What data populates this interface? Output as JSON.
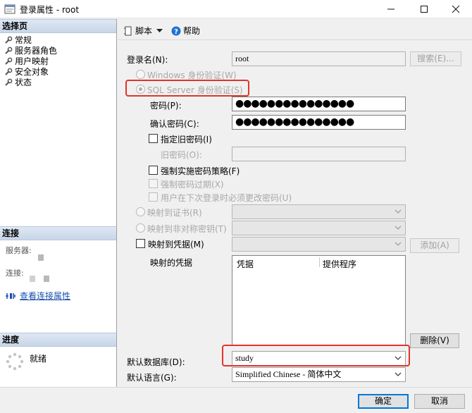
{
  "window": {
    "title": "登录属性 - root",
    "minimize_icon": "minimize-icon",
    "maximize_icon": "maximize-icon",
    "close_icon": "close-icon"
  },
  "left_pane": {
    "select_page_header": "选择页",
    "pages": [
      {
        "label": "常规",
        "icon": "wrench-icon"
      },
      {
        "label": "服务器角色",
        "icon": "wrench-icon"
      },
      {
        "label": "用户映射",
        "icon": "wrench-icon"
      },
      {
        "label": "安全对象",
        "icon": "wrench-icon"
      },
      {
        "label": "状态",
        "icon": "wrench-icon"
      }
    ],
    "connection_header": "连接",
    "server_label": "服务器:",
    "connection_label": "连接:",
    "view_connection_properties": "查看连接属性",
    "progress_header": "进度",
    "progress_status": "就绪"
  },
  "toolbar": {
    "script_label": "脚本",
    "help_label": "帮助"
  },
  "form": {
    "login_name_label": "登录名(N):",
    "login_name_value": "root",
    "search_button": "搜索(E)...",
    "windows_auth_label": "Windows 身份验证(W)",
    "sql_auth_label": "SQL Server 身份验证(S)",
    "password_label": "密码(P):",
    "password_value": "●●●●●●●●●●●●●●●",
    "confirm_password_label": "确认密码(C):",
    "confirm_password_value": "●●●●●●●●●●●●●●●",
    "specify_old_password_label": "指定旧密码(I)",
    "old_password_label": "旧密码(O):",
    "enforce_policy_label": "强制实施密码策略(F)",
    "enforce_expiration_label": "强制密码过期(X)",
    "must_change_label": "用户在下次登录时必须更改密码(U)",
    "map_certificate_label": "映射到证书(R)",
    "map_asym_key_label": "映射到非对称密钥(T)",
    "map_credential_label": "映射到凭据(M)",
    "add_button": "添加(A)",
    "mapped_credentials_label": "映射的凭据",
    "grid_columns": [
      "凭据",
      "提供程序"
    ],
    "remove_button": "删除(V)",
    "default_database_label": "默认数据库(D):",
    "default_database_value": "study",
    "default_language_label": "默认语言(G):",
    "default_language_value": "Simplified Chinese - 简体中文"
  },
  "footer": {
    "ok_button": "确定",
    "cancel_button": "取消"
  },
  "colors": {
    "highlight_box": "#e0342c",
    "link": "#1a4fb0",
    "section_header_bg": "#c8d6e8"
  }
}
